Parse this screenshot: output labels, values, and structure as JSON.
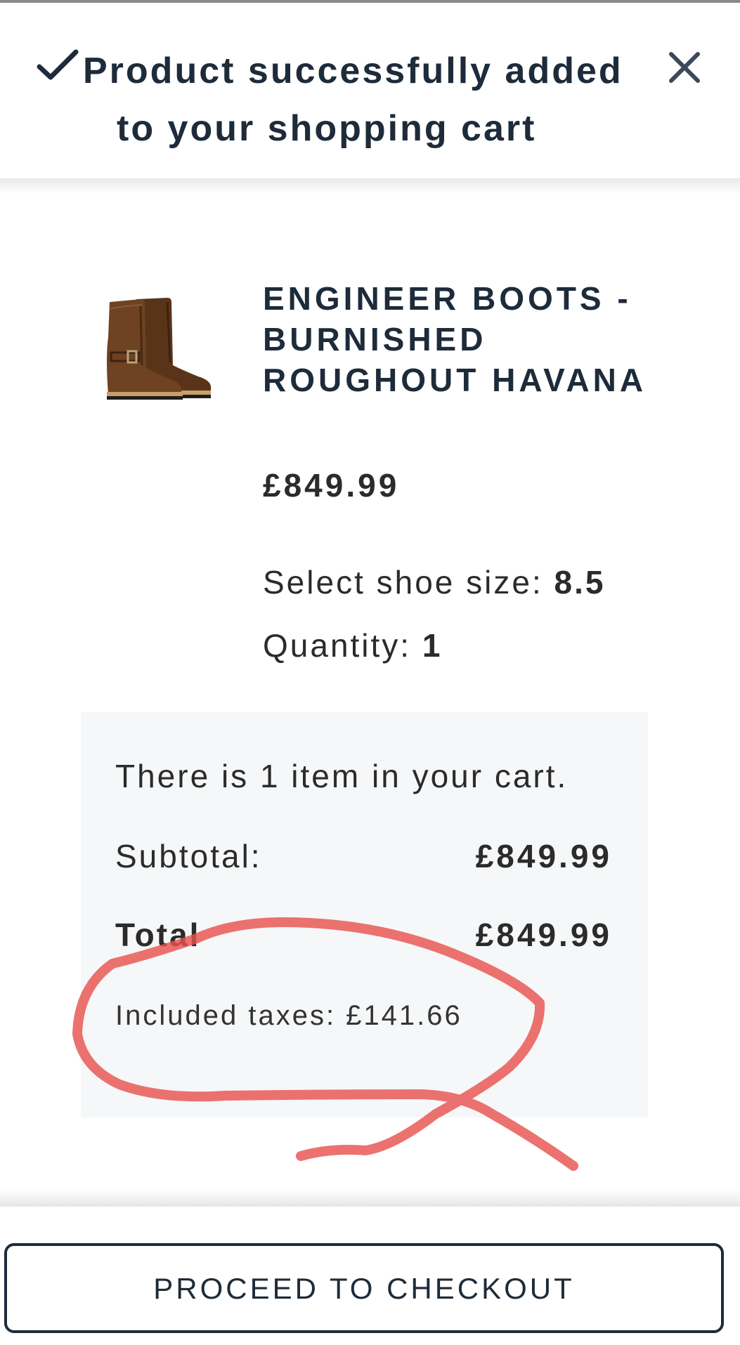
{
  "header": {
    "title_line1": "Product successfully added",
    "title_line2": "to your shopping cart",
    "check_icon": "check-icon",
    "close_icon": "close-icon"
  },
  "product": {
    "name": "ENGINEER BOOTS - BURNISHED ROUGHOUT HAVANA",
    "image_icon": "boot-image",
    "price": "£849.99",
    "size_label": "Select shoe size:",
    "size_value": "8.5",
    "quantity_label": "Quantity:",
    "quantity_value": "1"
  },
  "cart": {
    "count_text": "There is 1 item in your cart.",
    "subtotal_label": "Subtotal:",
    "subtotal_value": "£849.99",
    "total_label": "Total",
    "total_value": "£849.99",
    "taxes_text": "Included taxes: £141.66"
  },
  "footer": {
    "checkout_label": "PROCEED TO CHECKOUT"
  },
  "colors": {
    "navy": "#1d2b3a",
    "text": "#2b2b2b",
    "summary_bg": "#f6f7f8",
    "annotation_red": "#e8534f"
  }
}
